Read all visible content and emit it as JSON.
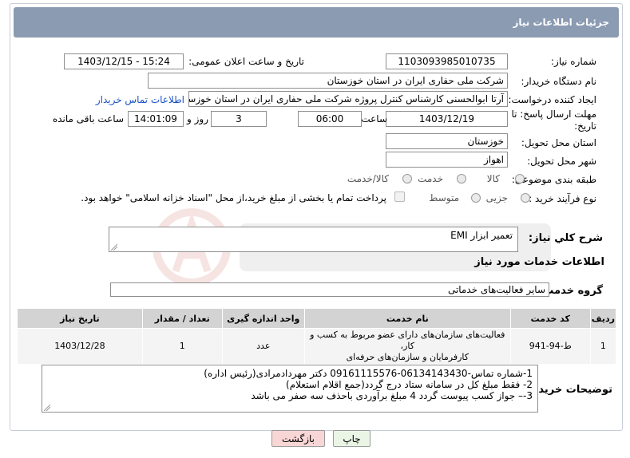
{
  "header": {
    "title": "جزئیات اطلاعات نیاز"
  },
  "fields": {
    "need_number_label": "شماره نیاز:",
    "need_number": "1103093985010735",
    "announce_label": "تاریخ و ساعت اعلان عمومی:",
    "announce_value": "1403/12/15 - 15:24",
    "buyer_org_label": "نام دستگاه خریدار:",
    "buyer_org": "شرکت ملی حفاری ایران در استان خوزستان",
    "creator_label": "ایجاد کننده درخواست:",
    "creator": "آرتا ابوالحسنی کارشناس کنترل پروژه شرکت ملی حفاری ایران در استان خوزستان",
    "buyer_contact_link": "اطلاعات تماس خریدار",
    "deadline_label_1": "مهلت ارسال پاسخ: تا",
    "deadline_label_2": "تاریخ:",
    "deadline_date": "1403/12/19",
    "time_label": "ساعت",
    "deadline_time": "06:00",
    "days": "3",
    "days_label": "روز و",
    "remaining": "14:01:09",
    "remaining_label": "ساعت باقی مانده",
    "province_label": "استان محل تحویل:",
    "province": "خوزستان",
    "city_label": "شهر محل تحویل:",
    "city": "اهواز",
    "category_label": "طبقه بندی موضوعی:",
    "category_options": [
      "کالا",
      "خدمت",
      "کالا/خدمت"
    ],
    "process_label": "نوع فرآیند خرید :",
    "process_options": [
      "جزیی",
      "متوسط"
    ],
    "payment_note": "پرداخت تمام یا بخشی از مبلغ خرید،از محل \"اسناد خزانه اسلامی\" خواهد بود."
  },
  "summary": {
    "label": "شرح کلي نياز:",
    "value": "تعمیر ابزار EMI"
  },
  "services_title": "اطلاعات خدمات مورد نیاز",
  "service_group": {
    "label": "گروه خدمت:",
    "value": "سایر فعالیت‌های خدماتی"
  },
  "table": {
    "headers": [
      "ردیف",
      "کد خدمت",
      "نام خدمت",
      "واحد اندازه گیری",
      "تعداد / مقدار",
      "تاریخ نیاز"
    ],
    "rows": [
      {
        "index": "1",
        "code": "ط-94-941",
        "name_line1": "فعالیت‌های سازمان‌های دارای عضو مربوط به کسب و کار،",
        "name_line2": "کارفرمایان و سازمان‌های حرفه‌ای",
        "unit": "عدد",
        "qty": "1",
        "date": "1403/12/28"
      }
    ]
  },
  "buyer_notes": {
    "label": "توضیحات خریدار:",
    "lines": [
      "1-شماره تماس-06134143430-09161115576 دکتر مهردادمرادی(رئیس اداره)",
      "2- فقط مبلغ کل در سامانه ستاد درج گردد(جمع اقلام استعلام)",
      "3-– جواز کسب  پیوست گردد 4 مبلغ برآوردی باحذف سه صفر می باشد"
    ]
  },
  "buttons": {
    "print": "چاپ",
    "back": "بازگشت"
  },
  "colors": {
    "header_bg": "#8b9bb2",
    "link": "#1a53c4",
    "back_bg": "#f9d6d6",
    "print_bg": "#eaf5e6"
  }
}
